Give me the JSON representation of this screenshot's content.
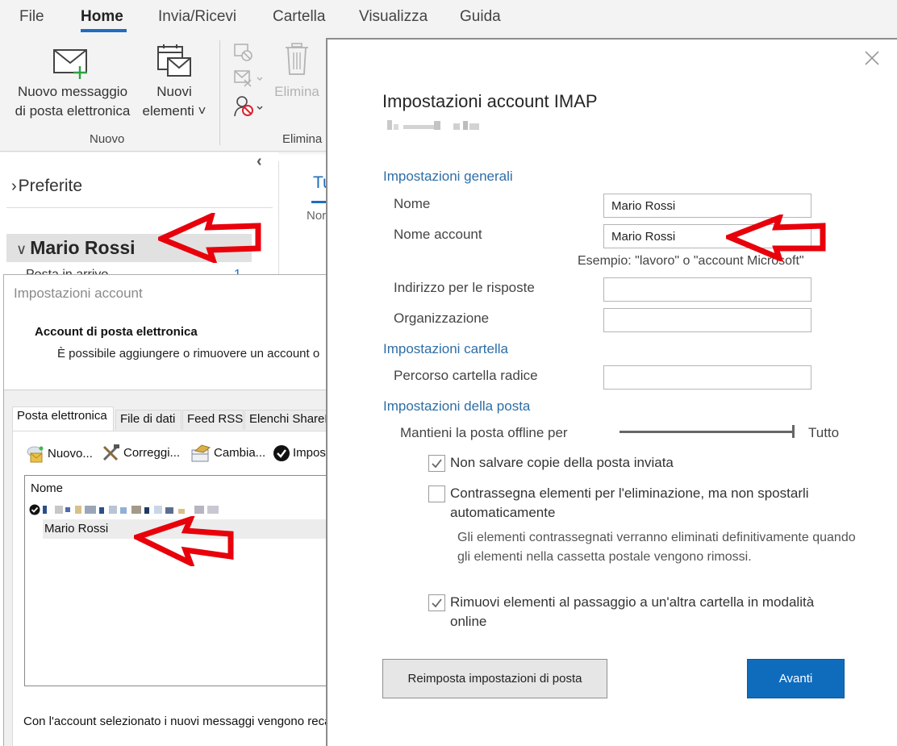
{
  "ribbon": {
    "tabs": [
      {
        "label": "File"
      },
      {
        "label": "Home",
        "active": true
      },
      {
        "label": "Invia/Ricevi"
      },
      {
        "label": "Cartella"
      },
      {
        "label": "Visualizza"
      },
      {
        "label": "Guida"
      }
    ],
    "new_email": {
      "line1": "Nuovo messaggio",
      "line2": "di posta elettronica",
      "icon": "new-mail-icon"
    },
    "new_items": {
      "line1": "Nuovi",
      "line2": "elementi ˅",
      "icon": "new-items-icon"
    },
    "group_new": "Nuovo",
    "delete_button": "Elimina",
    "group_delete": "Elimina",
    "accent": "#1f6dbf"
  },
  "nav": {
    "collapse_glyph": "‹",
    "favorites": "Preferite",
    "account": "Mario Rossi",
    "inbox": "Posta in arrivo",
    "inbox_count": "1",
    "list_tab": "Tu",
    "list_sub": "Nor"
  },
  "account_settings": {
    "title": "Impostazioni account",
    "heading": "Account di posta elettronica",
    "description": "È possibile aggiungere o rimuovere un account o",
    "tabs": [
      {
        "label": "Posta elettronica",
        "active": true
      },
      {
        "label": "File di dati"
      },
      {
        "label": "Feed RSS"
      },
      {
        "label": "Elenchi SharePoint"
      }
    ],
    "toolbar": [
      {
        "label": "Nuovo...",
        "icon": "new-account-icon"
      },
      {
        "label": "Correggi...",
        "icon": "repair-icon"
      },
      {
        "label": "Cambia...",
        "icon": "change-icon"
      },
      {
        "label": "Imposta come predefinito",
        "icon": "default-check-icon"
      }
    ],
    "list_column": "Nome",
    "selected_account": "Mario Rossi",
    "footer": "Con l'account selezionato i nuovi messaggi vengono recapitati"
  },
  "imap": {
    "title": "Impostazioni account IMAP",
    "sections": {
      "general": "Impostazioni generali",
      "folder": "Impostazioni cartella",
      "mail": "Impostazioni della posta"
    },
    "fields": {
      "name": {
        "label": "Nome",
        "value": "Mario Rossi"
      },
      "account_name": {
        "label": "Nome account",
        "value": "Mario Rossi"
      },
      "account_name_hint": "Esempio: \"lavoro\" o \"account Microsoft\"",
      "reply_address": {
        "label": "Indirizzo per le risposte",
        "value": ""
      },
      "organization": {
        "label": "Organizzazione",
        "value": ""
      },
      "root_folder": {
        "label": "Percorso cartella radice",
        "value": ""
      }
    },
    "offline": {
      "label": "Mantieni la posta offline per",
      "value": "Tutto",
      "slider_fraction": 1.0
    },
    "checkboxes": [
      {
        "label": "Non salvare copie della posta inviata",
        "checked": true
      },
      {
        "label": "Contrassegna elementi per l'eliminazione, ma non spostarli automaticamente",
        "checked": false
      },
      {
        "label": "Rimuovi elementi al passaggio a un'altra cartella in modalità online",
        "checked": true
      }
    ],
    "purge_note": "Gli elementi contrassegnati verranno eliminati definitivamente quando gli elementi nella cassetta postale vengono rimossi.",
    "reset_button": "Reimposta impostazioni di posta",
    "next_button": "Avanti",
    "primary_color": "#0f6cbd",
    "section_color": "#2e6ea6"
  },
  "annotations": {
    "arrow_color": "#e8000b"
  }
}
